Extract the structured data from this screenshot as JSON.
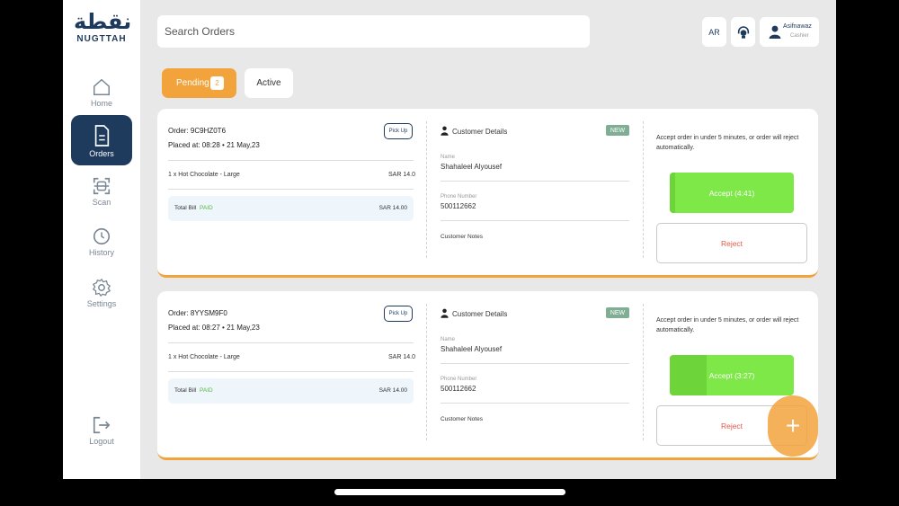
{
  "brand": {
    "arabic": "نقطة",
    "name": "NUGTTAH"
  },
  "nav": [
    {
      "label": "Home",
      "icon": "home-icon"
    },
    {
      "label": "Orders",
      "icon": "orders-icon",
      "active": true
    },
    {
      "label": "Scan",
      "icon": "scan-icon"
    },
    {
      "label": "History",
      "icon": "history-icon"
    },
    {
      "label": "Settings",
      "icon": "settings-icon"
    },
    {
      "label": "Logout",
      "icon": "logout-icon"
    }
  ],
  "search": {
    "placeholder": "Search Orders"
  },
  "header": {
    "lang": "AR",
    "user_name": "Asifnawaz",
    "user_role": "Cashier"
  },
  "tabs": {
    "pending_label": "Pending",
    "pending_count": "2",
    "active_label": "Active"
  },
  "orders": [
    {
      "order_id": "Order: 9C9HZ0T6",
      "placed": "Placed at: 08:28 • 21 May,23",
      "pickup": "Pick Up",
      "item": "1 x Hot Chocolate - Large",
      "item_price": "SAR 14.0",
      "bill_label": "Total Bill",
      "bill_status": "PAID",
      "bill_total": "SAR 14.00",
      "customer_title": "Customer Details",
      "badge": "NEW",
      "name_label": "Name",
      "name": "Shahaleel Alyousef",
      "phone_label": "Phone Number",
      "phone": "500112662",
      "notes_label": "Customer Notes",
      "message": "Accept order in under 5 minutes, or order will reject automatically.",
      "accept": "Accept (4:41)",
      "accept_progress": 0.04,
      "reject": "Reject"
    },
    {
      "order_id": "Order: 8YYSM9F0",
      "placed": "Placed at: 08:27 • 21 May,23",
      "pickup": "Pick Up",
      "item": "1 x Hot Chocolate - Large",
      "item_price": "SAR 14.0",
      "bill_label": "Total Bill",
      "bill_status": "PAID",
      "bill_total": "SAR 14.00",
      "customer_title": "Customer Details",
      "badge": "NEW",
      "name_label": "Name",
      "name": "Shahaleel Alyousef",
      "phone_label": "Phone Number",
      "phone": "500112662",
      "notes_label": "Customer Notes",
      "message": "Accept order in under 5 minutes, or order will reject automatically.",
      "accept": "Accept (3:27)",
      "accept_progress": 0.3,
      "reject": "Reject"
    }
  ],
  "fab": {
    "symbol": "+"
  },
  "colors": {
    "accent": "#f2a33c",
    "primary": "#1e3a5c",
    "accept": "#7ee848",
    "reject": "#e05a4a",
    "paid": "#58b947"
  }
}
